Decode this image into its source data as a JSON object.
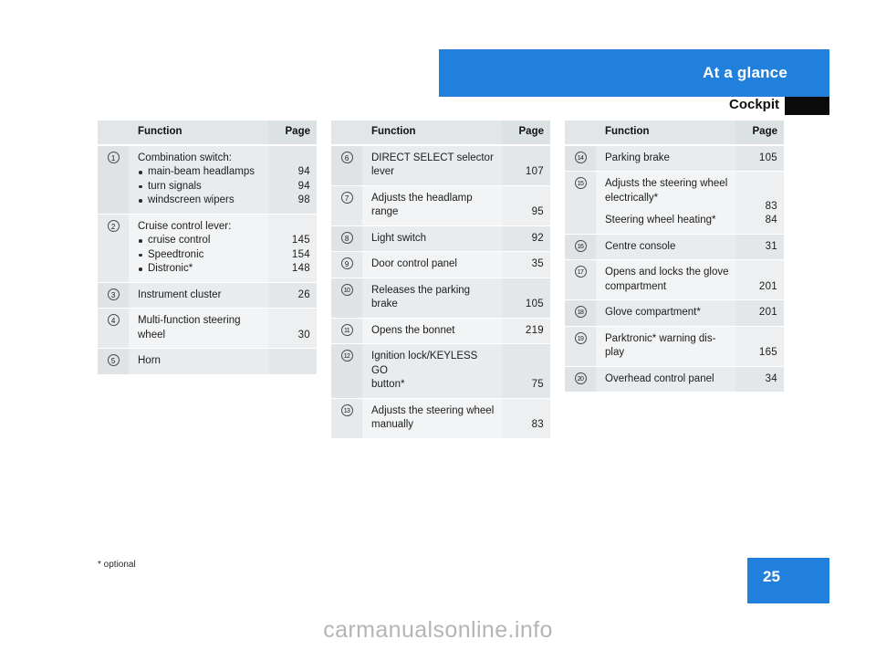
{
  "header": {
    "title": "At a glance",
    "section": "Cockpit"
  },
  "footer": {
    "footnote": "* optional",
    "page_number": "25",
    "watermark": "carmanualsonline.info"
  },
  "colors": {
    "accent_blue": "#2180dc",
    "tab_black": "#0b0b0b",
    "header_row": "#e2e6e8",
    "row_shade_a": "#e9ecee",
    "row_shade_b": "#f2f4f5"
  },
  "tables": [
    {
      "id": "table-left",
      "columns": {
        "function": "Function",
        "page": "Page"
      },
      "rows": [
        {
          "num": "1",
          "lines": [
            {
              "text": "Combination switch:",
              "bullet": false,
              "page": ""
            },
            {
              "text": "main-beam headlamps",
              "bullet": true,
              "page": "94"
            },
            {
              "text": "turn signals",
              "bullet": true,
              "page": "94"
            },
            {
              "text": "windscreen wipers",
              "bullet": true,
              "page": "98"
            }
          ]
        },
        {
          "num": "2",
          "lines": [
            {
              "text": "Cruise control lever:",
              "bullet": false,
              "page": ""
            },
            {
              "text": "cruise control",
              "bullet": true,
              "page": "145"
            },
            {
              "text": "Speedtronic",
              "bullet": true,
              "page": "154"
            },
            {
              "text": "Distronic*",
              "bullet": true,
              "page": "148"
            }
          ]
        },
        {
          "num": "3",
          "lines": [
            {
              "text": "Instrument cluster",
              "bullet": false,
              "page": "26"
            }
          ]
        },
        {
          "num": "4",
          "lines": [
            {
              "text": "Multi-function steering",
              "bullet": false,
              "page": ""
            },
            {
              "text": "wheel",
              "bullet": false,
              "page": "30"
            }
          ]
        },
        {
          "num": "5",
          "lines": [
            {
              "text": "Horn",
              "bullet": false,
              "page": ""
            }
          ]
        }
      ]
    },
    {
      "id": "table-middle",
      "columns": {
        "function": "Function",
        "page": "Page"
      },
      "rows": [
        {
          "num": "6",
          "lines": [
            {
              "text": "DIRECT SELECT selector",
              "bullet": false,
              "page": ""
            },
            {
              "text": "lever",
              "bullet": false,
              "page": "107"
            }
          ]
        },
        {
          "num": "7",
          "lines": [
            {
              "text": "Adjusts the headlamp",
              "bullet": false,
              "page": ""
            },
            {
              "text": "range",
              "bullet": false,
              "page": "95"
            }
          ]
        },
        {
          "num": "8",
          "lines": [
            {
              "text": "Light switch",
              "bullet": false,
              "page": "92"
            }
          ]
        },
        {
          "num": "9",
          "lines": [
            {
              "text": "Door control panel",
              "bullet": false,
              "page": "35"
            }
          ]
        },
        {
          "num": "10",
          "lines": [
            {
              "text": "Releases the parking brake",
              "bullet": false,
              "page": "105"
            }
          ]
        },
        {
          "num": "11",
          "lines": [
            {
              "text": "Opens the bonnet",
              "bullet": false,
              "page": "219"
            }
          ]
        },
        {
          "num": "12",
          "lines": [
            {
              "text": "Ignition lock/KEYLESS GO",
              "bullet": false,
              "page": ""
            },
            {
              "text": "button*",
              "bullet": false,
              "page": "75"
            }
          ]
        },
        {
          "num": "13",
          "lines": [
            {
              "text": "Adjusts the steering wheel",
              "bullet": false,
              "page": ""
            },
            {
              "text": "manually",
              "bullet": false,
              "page": "83"
            }
          ]
        }
      ]
    },
    {
      "id": "table-right",
      "columns": {
        "function": "Function",
        "page": "Page"
      },
      "rows": [
        {
          "num": "14",
          "lines": [
            {
              "text": "Parking brake",
              "bullet": false,
              "page": "105"
            }
          ]
        },
        {
          "num": "15",
          "lines": [
            {
              "text": "Adjusts the steering wheel",
              "bullet": false,
              "page": ""
            },
            {
              "text": "electrically*",
              "bullet": false,
              "page": "83"
            },
            {
              "text": "Steering wheel heating*",
              "bullet": false,
              "page": "84",
              "gap": true
            }
          ]
        },
        {
          "num": "16",
          "lines": [
            {
              "text": "Centre console",
              "bullet": false,
              "page": "31"
            }
          ]
        },
        {
          "num": "17",
          "lines": [
            {
              "text": "Opens and locks the glove",
              "bullet": false,
              "page": ""
            },
            {
              "text": "compartment",
              "bullet": false,
              "page": "201"
            }
          ]
        },
        {
          "num": "18",
          "lines": [
            {
              "text": "Glove compartment*",
              "bullet": false,
              "page": "201"
            }
          ]
        },
        {
          "num": "19",
          "lines": [
            {
              "text": "Parktronic* warning dis-",
              "bullet": false,
              "page": ""
            },
            {
              "text": "play",
              "bullet": false,
              "page": "165"
            }
          ]
        },
        {
          "num": "20",
          "lines": [
            {
              "text": "Overhead control panel",
              "bullet": false,
              "page": "34"
            }
          ]
        }
      ]
    }
  ]
}
